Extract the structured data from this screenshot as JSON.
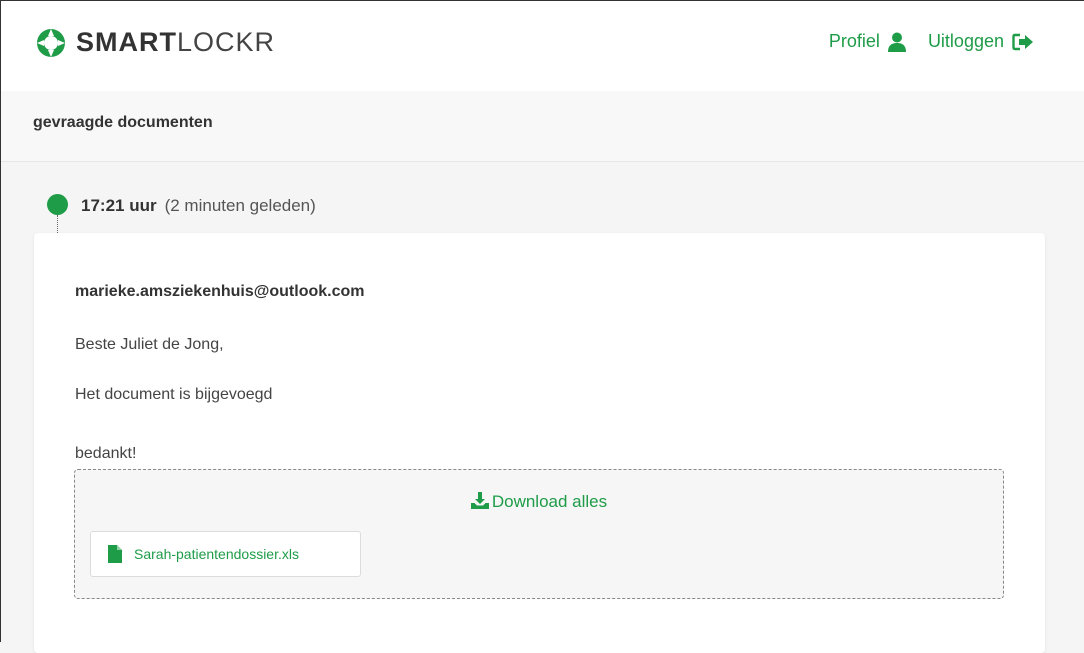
{
  "header": {
    "logo_bold": "SMART",
    "logo_light": "LOCKR",
    "nav": {
      "profile_label": "Profiel",
      "logout_label": "Uitloggen"
    }
  },
  "subheader": {
    "title": "gevraagde documenten"
  },
  "timeline": {
    "time": "17:21 uur",
    "relative": "(2 minuten geleden)"
  },
  "message": {
    "sender": "marieke.amsziekenhuis@outlook.com",
    "greeting": "Beste Juliet de Jong,",
    "body": "Het document is bijgevoegd",
    "closing": "bedankt!"
  },
  "attachments": {
    "download_all_label": "Download alles",
    "files": [
      {
        "name": "Sarah-patientendossier.xls"
      }
    ]
  },
  "colors": {
    "accent": "#1e9c48",
    "background": "#f5f5f5",
    "card": "#ffffff"
  },
  "icons": {
    "profile": "user-icon",
    "logout": "sign-out-icon",
    "download": "download-icon",
    "file": "file-icon"
  }
}
